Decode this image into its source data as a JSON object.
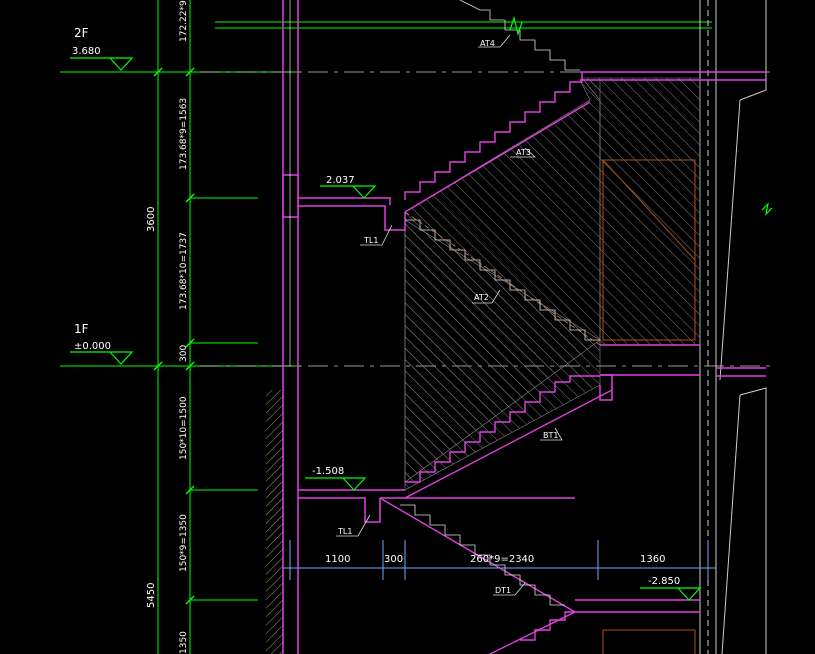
{
  "colors": {
    "background": "#000000",
    "wall": "#e040e0",
    "dim": "#00ff00",
    "text": "#ffffff",
    "hatch": "#888888",
    "axis": "#ffffff",
    "leader": "#ffffff",
    "blue": "#6fa8ff"
  },
  "levels": {
    "level_2f": {
      "name": "2F",
      "value": "3.680"
    },
    "level_1f": {
      "name": "1F",
      "value": "±0.000"
    },
    "level_a": {
      "value": "2.037"
    },
    "level_b": {
      "value": "-1.508"
    },
    "level_c": {
      "value": "-2.850"
    }
  },
  "vertical_dims": {
    "d1": "172.22*9",
    "d2": "173.68*9=1563",
    "d3": "173.68*10=1737",
    "d4": "300",
    "d5": "150*10=1500",
    "d6": "150*9=1350",
    "d7": "1350"
  },
  "overall_dims": {
    "upper": "3600",
    "lower": "5450"
  },
  "horizontal_dims": {
    "h1": "1100",
    "h2": "300",
    "h3": "260*9=2340",
    "h4": "1360"
  },
  "labels": {
    "at4": "AT4",
    "at3": "AT3",
    "at2": "AT2",
    "bt1": "BT1",
    "dt1": "DT1",
    "tl1_upper": "TL1",
    "tl1_lower": "TL1"
  }
}
